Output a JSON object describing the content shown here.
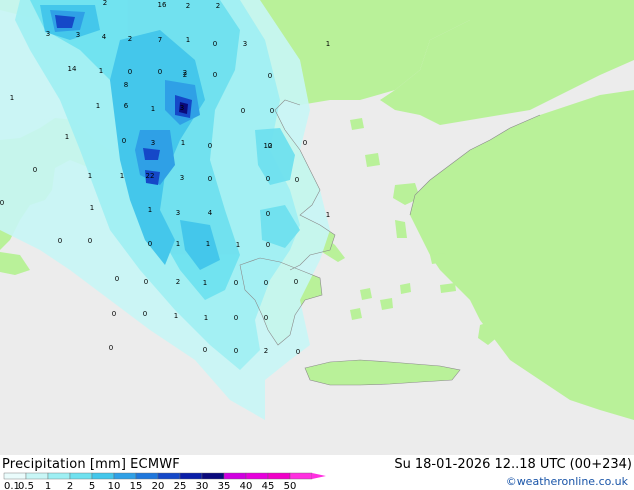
{
  "header": {
    "variable": "Precipitation",
    "unit": "[mm]",
    "model": "ECMWF",
    "day": "Su",
    "date": "18-01-2026",
    "time_range": "12..18",
    "timezone": "UTC",
    "run": "(00+234)"
  },
  "credit": "©weatheronline.co.uk",
  "legend": {
    "ticks": [
      "0.1",
      "0.5",
      "1",
      "2",
      "5",
      "10",
      "15",
      "20",
      "25",
      "30",
      "35",
      "40",
      "45",
      "50"
    ],
    "colors": [
      "#eafcfc",
      "#c8f6f6",
      "#9eeff3",
      "#6fe1ef",
      "#44c7eb",
      "#2fa0e6",
      "#1f77dc",
      "#1548c8",
      "#0a1ea8",
      "#0a0a7c",
      "#d000e0",
      "#e600dc",
      "#f000c8",
      "#ff30e0"
    ]
  },
  "colors": {
    "sea": "#ececec",
    "land": "#b9f199",
    "coast": "#8a8a8a"
  },
  "map_labels": [
    "3",
    "2",
    "2",
    "2",
    "16",
    "2",
    "1",
    "3",
    "4",
    "0",
    "2",
    "7",
    "3",
    "1",
    "0",
    "0",
    "1",
    "14",
    "1",
    "0",
    "2",
    "0",
    "0",
    "0",
    "0",
    "1",
    "6",
    "1",
    "1",
    "0",
    "1",
    "8",
    "3",
    "3",
    "0",
    "0",
    "12",
    "1",
    "1",
    "22",
    "3",
    "0",
    "0",
    "0",
    "0",
    "1",
    "1",
    "3",
    "4",
    "0",
    "0",
    "1",
    "0",
    "0",
    "0",
    "1",
    "1",
    "1",
    "0",
    "0",
    "0",
    "0",
    "2",
    "1",
    "0",
    "0",
    "0",
    "0",
    "1",
    "1",
    "0",
    "0",
    "0",
    "0",
    "0",
    "2",
    "0"
  ]
}
